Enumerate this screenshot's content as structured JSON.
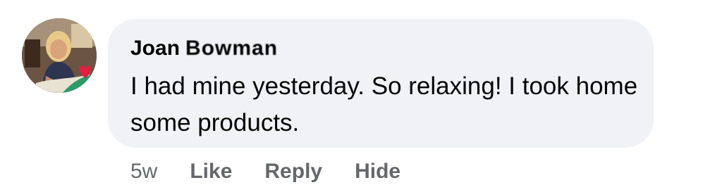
{
  "comment": {
    "author_first": "Joan",
    "author_last_redacted": "Bowman",
    "text": "I had mine yesterday. So relaxing! I took home some products.",
    "timestamp": "5w",
    "actions": {
      "like": "Like",
      "reply": "Reply",
      "hide": "Hide"
    }
  },
  "colors": {
    "bubble_bg": "#f0f2f5",
    "text": "#050505",
    "meta": "#65676b",
    "reaction_heart": "#e41e3f"
  }
}
